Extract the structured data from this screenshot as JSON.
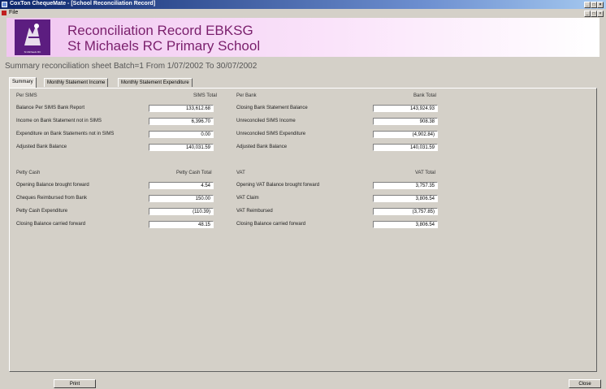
{
  "window": {
    "title": "CoxTon ChequeMate - [School Reconciliation Record]",
    "min": "_",
    "restore": "□",
    "close": "×"
  },
  "menu": {
    "file": "File"
  },
  "header": {
    "logo_icon": "school-crest",
    "logo_caption": "St Michaels RC",
    "title": "Reconciliation Record EBKSG",
    "school": "St Michaels RC Primary School",
    "bg_color": "#f0c6f0",
    "title_color": "#7a1f6c"
  },
  "summary_line": "Summary reconciliation sheet  Batch=1  From 1/07/2002 To 30/07/2002",
  "tabs": [
    {
      "label": "Summary",
      "active": true
    },
    {
      "label": "Monthly Statement Income",
      "active": false
    },
    {
      "label": "Monthly Statement Expenditure",
      "active": false
    }
  ],
  "sims": {
    "heading": "Per SIMS",
    "total_heading": "SIMS Total",
    "rows": [
      {
        "label": "Balance Per SIMS Bank Report",
        "value": "133,612.68"
      },
      {
        "label": "Income on Bank Statement not in SIMS",
        "value": "6,396.70"
      },
      {
        "label": "Expenditure on Bank Statements not in SIMS",
        "value": "0.00"
      },
      {
        "label": "Adjusted Bank Balance",
        "value": "140,031.59"
      }
    ]
  },
  "bank": {
    "heading": "Per Bank",
    "total_heading": "Bank Total",
    "rows": [
      {
        "label": "Closing Bank Statement Balance",
        "value": "143,924.93"
      },
      {
        "label": "Unreconciled SIMS Income",
        "value": "908.38"
      },
      {
        "label": "Unreconciled SIMS Expenditure",
        "value": "(4,902.84)"
      },
      {
        "label": "Adjusted Bank Balance",
        "value": "140,031.59"
      }
    ]
  },
  "petty": {
    "heading": "Petty Cash",
    "total_heading": "Petty Cash Total",
    "rows": [
      {
        "label": "Opening Balance brought forward",
        "value": "4.54"
      },
      {
        "label": "Cheques Reimbursed from Bank",
        "value": "150.00"
      },
      {
        "label": "Petty Cash Expenditure",
        "value": "(110.39)"
      },
      {
        "label": "Closing Balance carried forward",
        "value": "48.15"
      }
    ]
  },
  "vat": {
    "heading": "VAT",
    "total_heading": "VAT Total",
    "rows": [
      {
        "label": "Opening VAT Balance brought forward",
        "value": "3,757.35"
      },
      {
        "label": "VAT Claim",
        "value": "3,806.54"
      },
      {
        "label": "VAT Reimbursed",
        "value": "(3,757.85)"
      },
      {
        "label": "Closing Balance carried forward",
        "value": "3,806.54"
      }
    ]
  },
  "footer": {
    "print": "Print",
    "close": "Close"
  }
}
